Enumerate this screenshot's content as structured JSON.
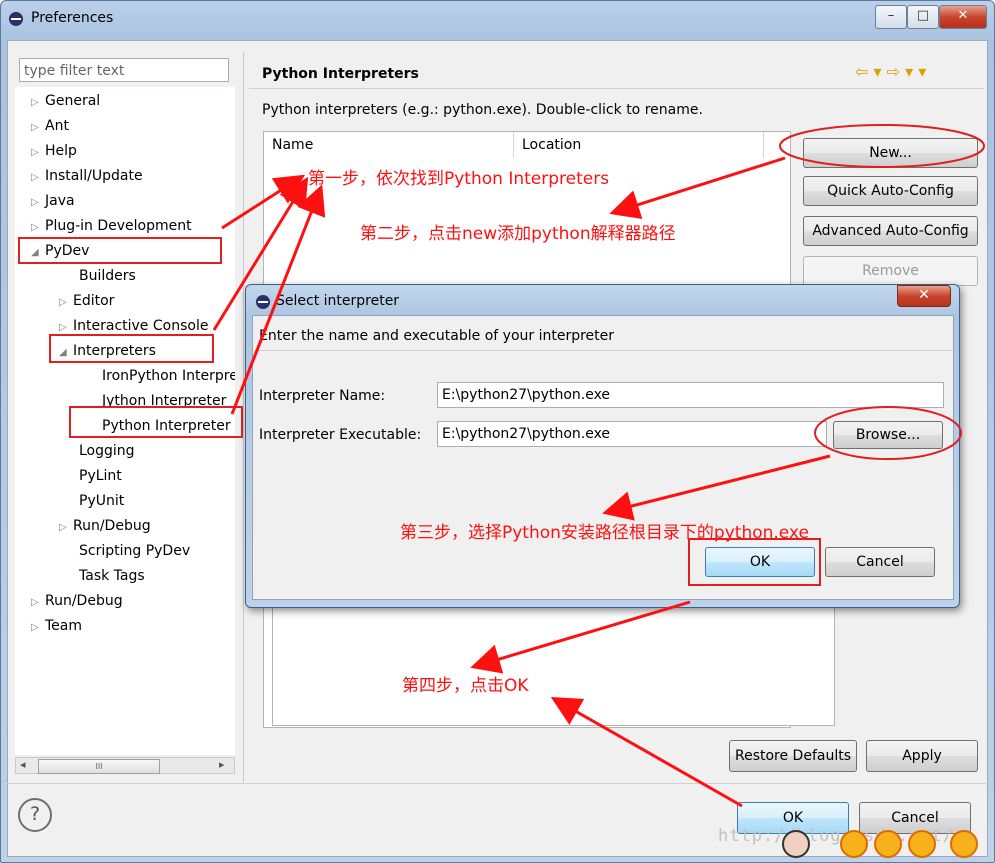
{
  "window": {
    "title": "Preferences",
    "min": "–",
    "max": "□",
    "close": "✕"
  },
  "filter": {
    "placeholder": "type filter text"
  },
  "tree": [
    {
      "label": "General",
      "expander": "▷"
    },
    {
      "label": "Ant",
      "expander": "▷"
    },
    {
      "label": "Help",
      "expander": "▷"
    },
    {
      "label": "Install/Update",
      "expander": "▷"
    },
    {
      "label": "Java",
      "expander": "▷"
    },
    {
      "label": "Plug-in Development",
      "expander": "▷"
    },
    {
      "label": "PyDev",
      "expander": "◢"
    },
    {
      "label": "Builders",
      "expander": ""
    },
    {
      "label": "Editor",
      "expander": "▷"
    },
    {
      "label": "Interactive Console",
      "expander": "▷"
    },
    {
      "label": "Interpreters",
      "expander": "◢"
    },
    {
      "label": "IronPython Interpreter",
      "expander": ""
    },
    {
      "label": "Jython Interpreter",
      "expander": ""
    },
    {
      "label": "Python Interpreter",
      "expander": ""
    },
    {
      "label": "Logging",
      "expander": ""
    },
    {
      "label": "PyLint",
      "expander": ""
    },
    {
      "label": "PyUnit",
      "expander": ""
    },
    {
      "label": "Run/Debug",
      "expander": "▷"
    },
    {
      "label": "Scripting PyDev",
      "expander": ""
    },
    {
      "label": "Task Tags",
      "expander": ""
    },
    {
      "label": "Run/Debug",
      "expander": "▷"
    },
    {
      "label": "Team",
      "expander": "▷"
    }
  ],
  "scroll": {
    "left": "◂",
    "thumb": "III",
    "right": "▸"
  },
  "page": {
    "title": "Python Interpreters",
    "nav": "⇦ ▾ ⇨ ▾ ▾",
    "description": "Python interpreters (e.g.: python.exe).   Double-click to rename.",
    "columns": [
      "Name",
      "Location"
    ],
    "buttons": {
      "new": "New...",
      "quick": "Quick Auto-Config",
      "advanced": "Advanced Auto-Config",
      "remove": "Remove"
    },
    "restore": "Restore Defaults",
    "apply": "Apply"
  },
  "footer": {
    "help": "?",
    "ok": "OK",
    "cancel": "Cancel"
  },
  "dialog": {
    "title": "Select interpreter",
    "close": "✕",
    "instruction": "Enter the name and executable of your interpreter",
    "name_label": "Interpreter Name:",
    "name_value": "E:\\python27\\python.exe",
    "exe_label": "Interpreter Executable:",
    "exe_value": "E:\\python27\\python.exe",
    "browse": "Browse...",
    "ok": "OK",
    "cancel": "Cancel"
  },
  "annotations": {
    "step1": "第一步，依次找到Python Interpreters",
    "step2": "第二步，点击new添加python解释器路径",
    "step3": "第三步，选择Python安装路径根目录下的python.exe",
    "step4": "第四步，点击OK",
    "color": "#ff1010"
  },
  "watermark": "http://blog.csdn.net/"
}
